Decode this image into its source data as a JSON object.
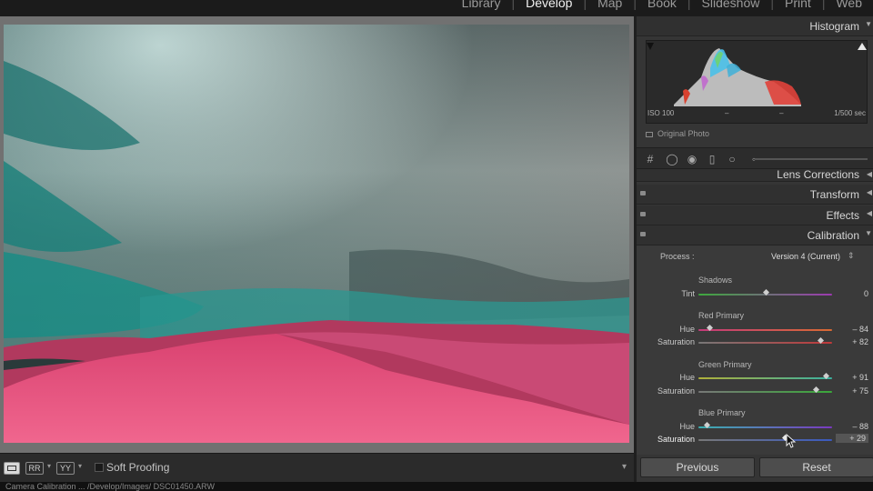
{
  "module_nav": {
    "items": [
      "Library",
      "Develop",
      "Map",
      "Book",
      "Slideshow",
      "Print",
      "Web"
    ],
    "active": "Develop"
  },
  "toolbar": {
    "view_loupe_label": "",
    "view_compare_label": "RR",
    "view_survey_label": "YY",
    "soft_proofing_label": "Soft Proofing",
    "soft_proofing_checked": false
  },
  "status_bar": {
    "text": "Camera Calibration  ...  /Develop/Images/  DSC01450.ARW"
  },
  "panel": {
    "histogram": {
      "title": "Histogram",
      "iso": "ISO 100",
      "focal": "–",
      "aperture": "–",
      "shutter": "1/500 sec",
      "original_photo_label": "Original Photo"
    },
    "sections": {
      "lens_corrections": "Lens Corrections",
      "transform": "Transform",
      "effects": "Effects",
      "calibration": "Calibration"
    },
    "calibration": {
      "process_label": "Process :",
      "process_value": "Version 4 (Current)",
      "shadows": {
        "title": "Shadows",
        "tint_label": "Tint",
        "tint_value": "0",
        "tint_level": 0
      },
      "red_primary": {
        "title": "Red Primary",
        "hue_label": "Hue",
        "hue_value": "– 84",
        "hue_level": -84,
        "sat_label": "Saturation",
        "sat_value": "+ 82",
        "sat_level": 82
      },
      "green_primary": {
        "title": "Green Primary",
        "hue_label": "Hue",
        "hue_value": "+ 91",
        "hue_level": 91,
        "sat_label": "Saturation",
        "sat_value": "+ 75",
        "sat_level": 75
      },
      "blue_primary": {
        "title": "Blue Primary",
        "hue_label": "Hue",
        "hue_value": "– 88",
        "hue_level": -88,
        "sat_label": "Saturation",
        "sat_value": "+ 29",
        "sat_level": 29
      }
    },
    "buttons": {
      "previous": "Previous",
      "reset": "Reset"
    }
  },
  "colors": {
    "dunes": "#e0507a",
    "sky_teal": "#1f8f86",
    "cloud_gray": "#7d8383"
  }
}
